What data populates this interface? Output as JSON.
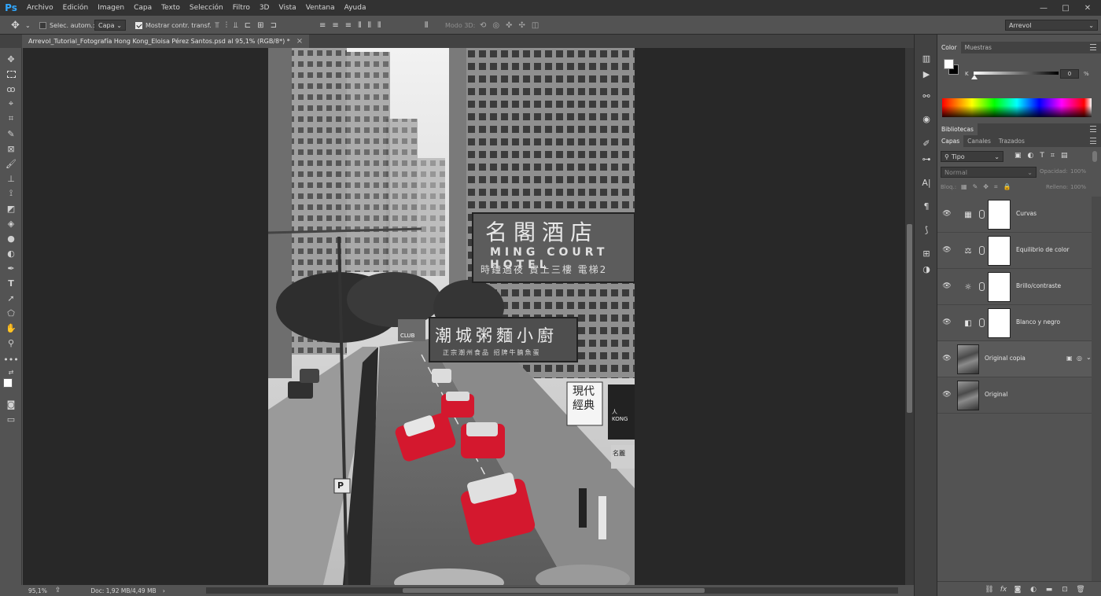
{
  "app": {
    "logo": "Ps",
    "menu": [
      "Archivo",
      "Edición",
      "Imagen",
      "Capa",
      "Texto",
      "Selección",
      "Filtro",
      "3D",
      "Vista",
      "Ventana",
      "Ayuda"
    ],
    "window_controls": [
      "—",
      "□",
      "✕"
    ]
  },
  "options_bar": {
    "auto_select_label": "Selec. autom.:",
    "auto_select_target": "Capa",
    "show_transform_label": "Mostrar contr. transf.",
    "mode_3d_label": "Modo 3D:",
    "workspace": "Arrevol"
  },
  "document": {
    "tab_title": "Arrevol_Tutorial_Fotografía Hong Kong_Eloisa Pérez Santos.psd al 95,1% (RGB/8*) *",
    "close_glyph": "×"
  },
  "status": {
    "zoom": "95,1%",
    "doc_info": "Doc: 1,92 MB/4,49 MB"
  },
  "photo": {
    "sign_ming_court_cn": "名閣酒店",
    "sign_ming_court_en": "MING COURT HOTEL",
    "sign_ming_court_sub": "時鐘過夜 實上三樓 電梯2",
    "sign_congee_cn": "潮城粥麵小廚",
    "sign_congee_sub": "正宗潮州食品 招牌牛腩魚蛋",
    "sign_club": "CLUB",
    "sign_modern": "現代經典",
    "sign_parking": "P",
    "sign_small_right": "人 KONG",
    "sign_small_right2": "名麗"
  },
  "color_panel": {
    "tabs": [
      "Color",
      "Muestras"
    ],
    "active_tab": 0,
    "channel_label": "K",
    "channel_value": "0",
    "channel_unit": "%",
    "slider_value": 0.0
  },
  "libraries_panel": {
    "title": "Bibliotecas"
  },
  "layers_panel": {
    "tabs": [
      "Capas",
      "Canales",
      "Trazados"
    ],
    "active_tab": 0,
    "filter_kind": "Tipo",
    "blend_mode": "Normal",
    "opacity_label": "Opacidad:",
    "opacity_value": "100%",
    "lock_label": "Bloq.:",
    "fill_label": "Relleno:",
    "fill_value": "100%",
    "layers": [
      {
        "name": "Curvas",
        "type": "adjustment",
        "icon": "curves-icon",
        "glyph": "▦"
      },
      {
        "name": "Equilibrio de color",
        "type": "adjustment",
        "icon": "color-balance-icon",
        "glyph": "⚖"
      },
      {
        "name": "Brillo/contraste",
        "type": "adjustment",
        "icon": "brightness-icon",
        "glyph": "☼"
      },
      {
        "name": "Blanco y negro",
        "type": "adjustment",
        "icon": "black-white-icon",
        "glyph": "◧"
      },
      {
        "name": "Original copia",
        "type": "image"
      },
      {
        "name": "Original",
        "type": "image"
      }
    ]
  },
  "colors": {
    "menubar": "#323232",
    "panel": "#535353",
    "canvas": "#282828",
    "accent": "#31a8ff",
    "taxi_red": "#d4182e"
  }
}
